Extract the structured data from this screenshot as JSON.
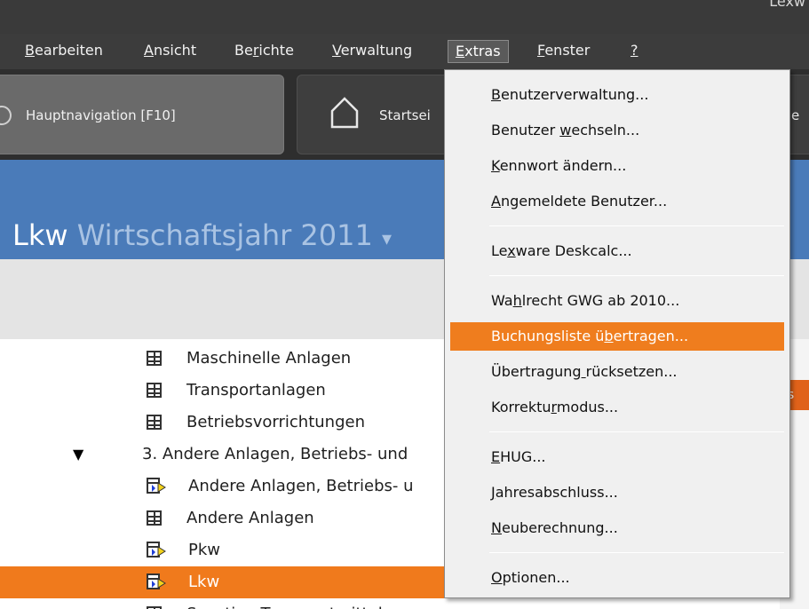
{
  "window": {
    "title_fragment": "Lexw"
  },
  "menubar": {
    "items": [
      {
        "label": "Bearbeiten",
        "mnemonic_index": 0
      },
      {
        "label": "Ansicht",
        "mnemonic_index": 0
      },
      {
        "label": "Berichte",
        "mnemonic_index": 2
      },
      {
        "label": "Verwaltung",
        "mnemonic_index": 0
      },
      {
        "label": "Extras",
        "mnemonic_index": 0
      },
      {
        "label": "Fenster",
        "mnemonic_index": 0
      },
      {
        "label": "?",
        "mnemonic_index": 0
      }
    ],
    "open_menu": "Extras"
  },
  "toolbar": {
    "hauptnav_label": "Hauptnavigation [F10]",
    "start_label": "Startsei",
    "third_label": "e"
  },
  "header": {
    "object_name": "Lkw",
    "year_label": "Wirtschaftsjahr",
    "year_value": "2011",
    "year_caret": "▾"
  },
  "tree": {
    "rows": [
      {
        "label": "Maschinelle Anlagen",
        "icon": "table-icon"
      },
      {
        "label": "Transportanlagen",
        "icon": "table-icon"
      },
      {
        "label": "Betriebsvorrichtungen",
        "icon": "table-icon"
      },
      {
        "label": "3. Andere Anlagen, Betriebs- und",
        "icon": "expander-down-icon"
      },
      {
        "label": "Andere Anlagen, Betriebs- u",
        "icon": "asset-arrow-icon"
      },
      {
        "label": "Andere Anlagen",
        "icon": "table-icon"
      },
      {
        "label": "Pkw",
        "icon": "asset-arrow-icon"
      },
      {
        "label": "Lkw",
        "icon": "asset-arrow-icon",
        "selected": true
      },
      {
        "label": "Sonstige Transportmittel",
        "icon": "table-icon"
      }
    ],
    "right_strip_text": "ns"
  },
  "dropdown": {
    "groups": [
      [
        {
          "label": "Benutzerverwaltung...",
          "mnemonic_index": 0
        },
        {
          "label": "Benutzer wechseln...",
          "mnemonic_index": 9
        },
        {
          "label": "Kennwort ändern...",
          "mnemonic_index": 0
        },
        {
          "label": "Angemeldete Benutzer...",
          "mnemonic_index": 0
        }
      ],
      [
        {
          "label": "Lexware Deskcalc...",
          "mnemonic_index": 2
        }
      ],
      [
        {
          "label": "Wahlrecht GWG ab 2010...",
          "mnemonic_index": 2
        },
        {
          "label": "Buchungsliste übertragen...",
          "mnemonic_index": 15,
          "highlighted": true
        },
        {
          "label": "Übertragung rücksetzen...",
          "mnemonic_index": 11
        },
        {
          "label": "Korrekturmodus...",
          "mnemonic_index": 8
        }
      ],
      [
        {
          "label": "EHUG...",
          "mnemonic_index": 0
        },
        {
          "label": "Jahresabschluss...",
          "mnemonic_index": 0
        },
        {
          "label": "Neuberechnung...",
          "mnemonic_index": 0
        }
      ],
      [
        {
          "label": "Optionen...",
          "mnemonic_index": 0
        }
      ]
    ]
  },
  "colors": {
    "accent_orange": "#ef7d1e",
    "header_blue": "#4a7bb9",
    "menubar_dark": "#3c3c3c"
  }
}
